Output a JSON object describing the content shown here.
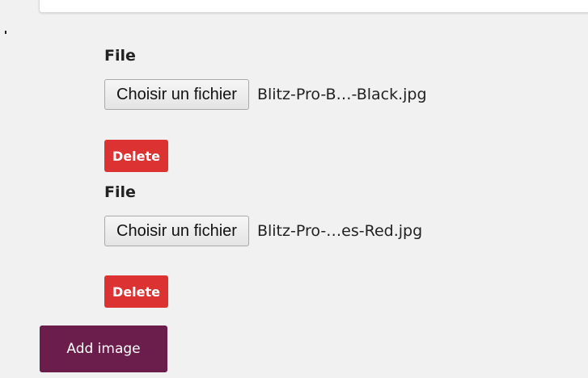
{
  "images": [
    {
      "label": "File",
      "choose_label": "Choisir un fichier",
      "file_name": "Blitz-Pro-B…-Black.jpg",
      "delete_label": "Delete"
    },
    {
      "label": "File",
      "choose_label": "Choisir un fichier",
      "file_name": "Blitz-Pro-…es-Red.jpg",
      "delete_label": "Delete"
    }
  ],
  "add_image_label": "Add image",
  "colors": {
    "delete": "#dc3232",
    "add_image": "#6b1d4b",
    "background": "#f1f1f1"
  }
}
